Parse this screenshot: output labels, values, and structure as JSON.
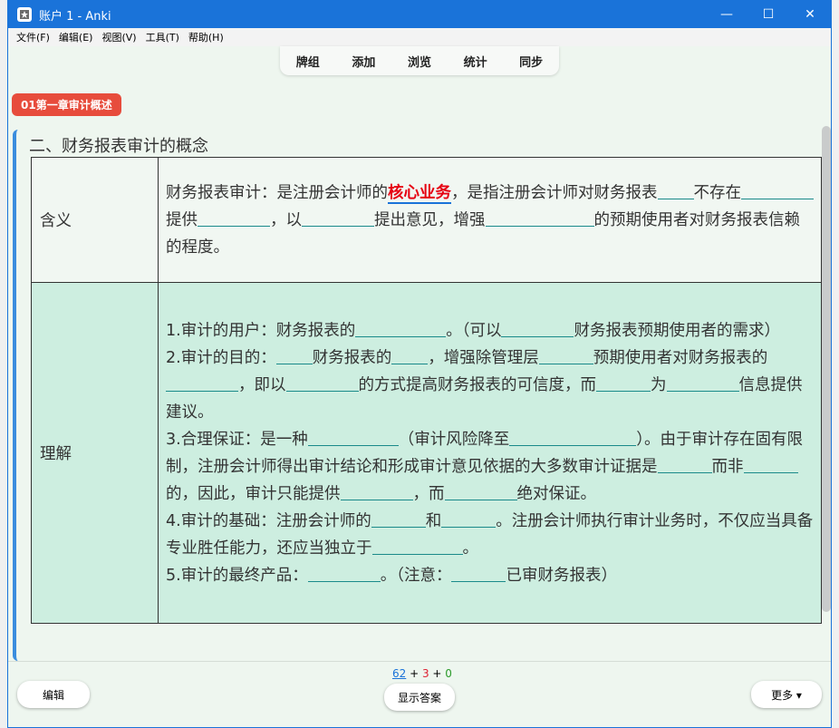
{
  "window": {
    "title": "账户 1 - Anki"
  },
  "titlebar_controls": {
    "minimize": "—",
    "maximize": "☐",
    "close": "✕"
  },
  "menu": [
    "文件(F)",
    "编辑(E)",
    "视图(V)",
    "工具(T)",
    "帮助(H)"
  ],
  "toolbar": [
    "牌组",
    "添加",
    "浏览",
    "统计",
    "同步"
  ],
  "deck_tag": "01第一章审计概述",
  "card": {
    "title": "二、财务报表审计的概念",
    "row1": {
      "label": "含义",
      "p1": "财务报表审计：是注册会计师的",
      "highlight": "核心业务",
      "p2": "，是指注册会计师对财务报表",
      "p3": "不存在",
      "p4": "提供",
      "p5": "，以",
      "p6": "提出意见，增强",
      "p7": "的预期使用者对财务报表信赖的程度。"
    },
    "row2": {
      "label": "理解",
      "l1a": "1.审计的用户：财务报表的",
      "l1b": "。（可以",
      "l1c": "财务报表预期使用者的需求）",
      "l2a": "2.审计的目的：",
      "l2b": "财务报表的",
      "l2c": "，增强除管理层",
      "l2d": "预期使用者对财务报表的",
      "l2e": "，即以",
      "l2f": "的方式提高财务报表的可信度，而",
      "l2g": "为",
      "l2h": "信息提供建议。",
      "l3a": "3.合理保证：是一种",
      "l3b": "（审计风险降至",
      "l3c": "）。由于审计存在固有限制，注册会计师得出审计结论和形成审计意见依据的大多数审计证据是",
      "l3d": "而非",
      "l3e": "的，因此，审计只能提供",
      "l3f": "，而",
      "l3g": "绝对保证。",
      "l4a": "4.审计的基础：注册会计师的",
      "l4b": "和",
      "l4c": "。注册会计师执行审计业务时，不仅应当具备专业胜任能力，还应当独立于",
      "l4d": "。",
      "l5a": "5.审计的最终产品：",
      "l5b": "。（注意：",
      "l5c": "已审财务报表）"
    }
  },
  "bottom": {
    "count_new": "62",
    "plus1": " + ",
    "count_learn": "3",
    "plus2": " + ",
    "count_review": "0",
    "edit": "编辑",
    "show_answer": "显示答案",
    "more": "更多 ▾"
  },
  "colors": {
    "titlebar": "#1a73d9",
    "background": "#eef6ef",
    "highlight": "#e60012",
    "tag": "#e74c3c"
  }
}
